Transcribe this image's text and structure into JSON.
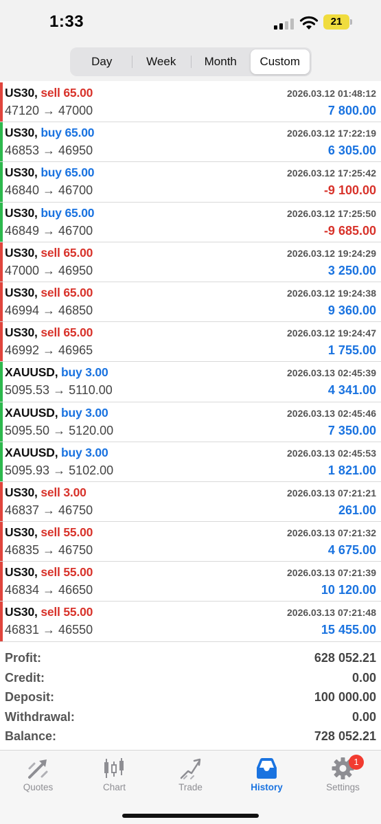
{
  "status_bar": {
    "time": "1:33",
    "battery": "21"
  },
  "period_tabs": [
    {
      "label": "Day",
      "active": false
    },
    {
      "label": "Week",
      "active": false
    },
    {
      "label": "Month",
      "active": false
    },
    {
      "label": "Custom",
      "active": true
    }
  ],
  "deals": [
    {
      "symbol": "US30,",
      "side": "sell",
      "volume": "65.00",
      "prices": "47120 → 47000",
      "time": "2026.03.12 01:48:12",
      "profit": "7 800.00",
      "profit_sign": "positive"
    },
    {
      "symbol": "US30,",
      "side": "buy",
      "volume": "65.00",
      "prices": "46853 → 46950",
      "time": "2026.03.12 17:22:19",
      "profit": "6 305.00",
      "profit_sign": "positive"
    },
    {
      "symbol": "US30,",
      "side": "buy",
      "volume": "65.00",
      "prices": "46840 → 46700",
      "time": "2026.03.12 17:25:42",
      "profit": "-9 100.00",
      "profit_sign": "negative"
    },
    {
      "symbol": "US30,",
      "side": "buy",
      "volume": "65.00",
      "prices": "46849 → 46700",
      "time": "2026.03.12 17:25:50",
      "profit": "-9 685.00",
      "profit_sign": "negative"
    },
    {
      "symbol": "US30,",
      "side": "sell",
      "volume": "65.00",
      "prices": "47000 → 46950",
      "time": "2026.03.12 19:24:29",
      "profit": "3 250.00",
      "profit_sign": "positive"
    },
    {
      "symbol": "US30,",
      "side": "sell",
      "volume": "65.00",
      "prices": "46994 → 46850",
      "time": "2026.03.12 19:24:38",
      "profit": "9 360.00",
      "profit_sign": "positive"
    },
    {
      "symbol": "US30,",
      "side": "sell",
      "volume": "65.00",
      "prices": "46992 → 46965",
      "time": "2026.03.12 19:24:47",
      "profit": "1 755.00",
      "profit_sign": "positive"
    },
    {
      "symbol": "XAUUSD,",
      "side": "buy",
      "volume": "3.00",
      "prices": "5095.53 → 5110.00",
      "time": "2026.03.13 02:45:39",
      "profit": "4 341.00",
      "profit_sign": "positive"
    },
    {
      "symbol": "XAUUSD,",
      "side": "buy",
      "volume": "3.00",
      "prices": "5095.50 → 5120.00",
      "time": "2026.03.13 02:45:46",
      "profit": "7 350.00",
      "profit_sign": "positive"
    },
    {
      "symbol": "XAUUSD,",
      "side": "buy",
      "volume": "3.00",
      "prices": "5095.93 → 5102.00",
      "time": "2026.03.13 02:45:53",
      "profit": "1 821.00",
      "profit_sign": "positive"
    },
    {
      "symbol": "US30,",
      "side": "sell",
      "volume": "3.00",
      "prices": "46837 → 46750",
      "time": "2026.03.13 07:21:21",
      "profit": "261.00",
      "profit_sign": "positive"
    },
    {
      "symbol": "US30,",
      "side": "sell",
      "volume": "55.00",
      "prices": "46835 → 46750",
      "time": "2026.03.13 07:21:32",
      "profit": "4 675.00",
      "profit_sign": "positive"
    },
    {
      "symbol": "US30,",
      "side": "sell",
      "volume": "55.00",
      "prices": "46834 → 46650",
      "time": "2026.03.13 07:21:39",
      "profit": "10 120.00",
      "profit_sign": "positive"
    },
    {
      "symbol": "US30,",
      "side": "sell",
      "volume": "55.00",
      "prices": "46831 → 46550",
      "time": "2026.03.13 07:21:48",
      "profit": "15 455.00",
      "profit_sign": "positive"
    }
  ],
  "summary": [
    {
      "label": "Profit:",
      "value": "628 052.21"
    },
    {
      "label": "Credit:",
      "value": "0.00"
    },
    {
      "label": "Deposit:",
      "value": "100 000.00"
    },
    {
      "label": "Withdrawal:",
      "value": "0.00"
    },
    {
      "label": "Balance:",
      "value": "728 052.21"
    }
  ],
  "tabbar": {
    "items": [
      {
        "label": "Quotes",
        "icon": "quotes-icon",
        "active": false
      },
      {
        "label": "Chart",
        "icon": "chart-icon",
        "active": false
      },
      {
        "label": "Trade",
        "icon": "trade-icon",
        "active": false
      },
      {
        "label": "History",
        "icon": "history-icon",
        "active": true
      },
      {
        "label": "Settings",
        "icon": "gear-icon",
        "active": false,
        "badge": "1"
      }
    ]
  },
  "colors": {
    "buy": "#1a73e0",
    "sell": "#d8332b",
    "profit_positive": "#1a73e0",
    "profit_negative": "#d8332b",
    "accent": "#1a73e0",
    "badge": "#f23b30"
  }
}
